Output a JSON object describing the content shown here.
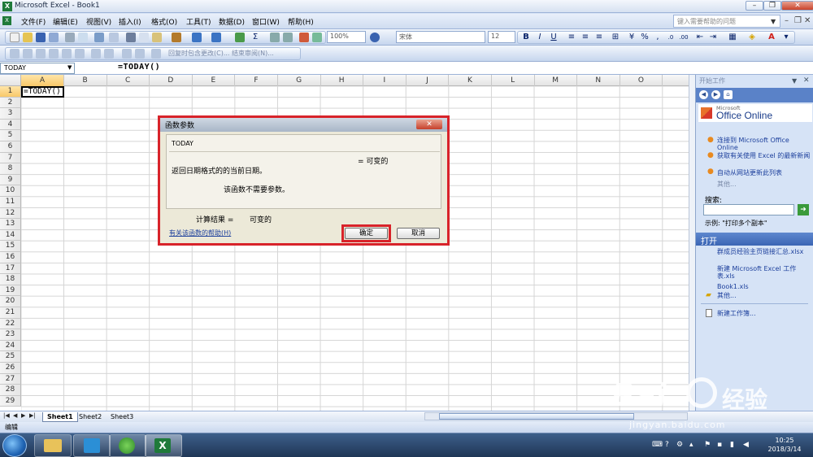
{
  "window": {
    "title": "Microsoft Excel - Book1"
  },
  "menu": {
    "items": [
      "文件(F)",
      "编辑(E)",
      "视图(V)",
      "插入(I)",
      "格式(O)",
      "工具(T)",
      "数据(D)",
      "窗口(W)",
      "帮助(H)"
    ],
    "help_placeholder": "键入需要帮助的问题"
  },
  "toolbar": {
    "zoom": "100%",
    "font": "宋体",
    "font_size": "12",
    "bold": "B",
    "italic": "I",
    "underline": "U",
    "reply_label": "回复时包含更改(C)... 结束审阅(N)..."
  },
  "formula_bar": {
    "name_box": "TODAY",
    "formula": "=TODAY()"
  },
  "columns": [
    "A",
    "B",
    "C",
    "D",
    "E",
    "F",
    "G",
    "H",
    "I",
    "J",
    "K",
    "L",
    "M",
    "N",
    "O"
  ],
  "rows": [
    "1",
    "2",
    "3",
    "4",
    "5",
    "6",
    "7",
    "8",
    "9",
    "10",
    "11",
    "12",
    "13",
    "14",
    "15",
    "16",
    "17",
    "18",
    "19",
    "20",
    "21",
    "22",
    "23",
    "24",
    "25",
    "26",
    "27",
    "28",
    "29"
  ],
  "cell_a1": "=TODAY()",
  "dialog": {
    "title": "函数参数",
    "function": "TODAY",
    "equals_volatile": "= 可变的",
    "description": "返回日期格式的的当前日期。",
    "no_args": "该函数不需要参数。",
    "result_label": "计算结果 =",
    "result_value": "可变的",
    "help_link": "有关该函数的帮助(H)",
    "ok": "确定",
    "cancel": "取消"
  },
  "task_pane": {
    "title": "开始工作",
    "office_small": "Microsoft",
    "office_big": "Office Online",
    "links": [
      "连接到 Microsoft Office Online",
      "获取有关使用 Excel 的最新新闻",
      "自动从网站更新此列表"
    ],
    "more": "其他...",
    "search_label": "搜索:",
    "example": "示例: \"打印多个副本\"",
    "open_header": "打开",
    "files": [
      "群成员经验主页链接汇总.xlsx",
      "新建 Microsoft Excel 工作表.xls",
      "Book1.xls"
    ],
    "open_more": "其他...",
    "new_workbook": "新建工作簿..."
  },
  "sheets": [
    "Sheet1",
    "Sheet2",
    "Sheet3"
  ],
  "status": "编辑",
  "clock": {
    "time": "10:25",
    "date": "2018/3/14"
  },
  "watermark": {
    "brand": "Bai",
    "brand2": "经验",
    "url": "jingyan.baidu.com"
  }
}
